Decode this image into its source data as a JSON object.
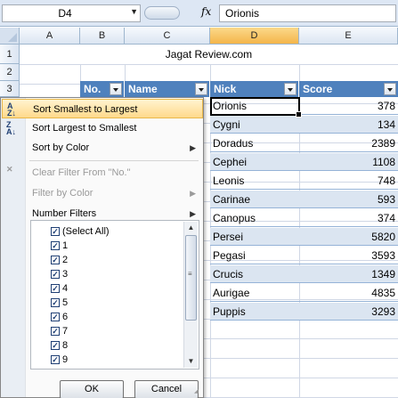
{
  "formula_bar": {
    "name_box": "D4",
    "fx_label": "fx",
    "formula": "Orionis"
  },
  "columns": [
    "A",
    "B",
    "C",
    "D",
    "E"
  ],
  "rows": [
    "1",
    "2",
    "3"
  ],
  "sheet": {
    "title": "Jagat Review.com",
    "headers": {
      "no": "No.",
      "name": "Name",
      "nick": "Nick",
      "score": "Score"
    },
    "data": [
      {
        "nick": "Orionis",
        "score": "378"
      },
      {
        "nick": "Cygni",
        "score": "134"
      },
      {
        "nick": "Doradus",
        "score": "2389"
      },
      {
        "nick": "Cephei",
        "score": "1108"
      },
      {
        "nick": "Leonis",
        "score": "748"
      },
      {
        "nick": "Carinae",
        "score": "593"
      },
      {
        "nick": "Canopus",
        "score": "374"
      },
      {
        "nick": "Persei",
        "score": "5820"
      },
      {
        "nick": "Pegasi",
        "score": "3593"
      },
      {
        "nick": "Crucis",
        "score": "1349"
      },
      {
        "nick": "Aurigae",
        "score": "4835"
      },
      {
        "nick": "Puppis",
        "score": "3293"
      }
    ]
  },
  "filter_menu": {
    "sort_asc": "Sort Smallest to Largest",
    "sort_desc": "Sort Largest to Smallest",
    "sort_color": "Sort by Color",
    "clear_filter": "Clear Filter From \"No.\"",
    "filter_color": "Filter by Color",
    "number_filters": "Number Filters",
    "icon_sort_asc": "sort-ascending-icon",
    "icon_sort_desc": "sort-descending-icon",
    "icon_clear": "clear-filter-icon",
    "check_items": [
      "(Select All)",
      "1",
      "2",
      "3",
      "4",
      "5",
      "6",
      "7",
      "8",
      "9"
    ],
    "ok": "OK",
    "cancel": "Cancel"
  },
  "colors": {
    "header_blue": "#4f81bd",
    "band": "#dbe5f1",
    "highlight": "#ffd98b"
  }
}
